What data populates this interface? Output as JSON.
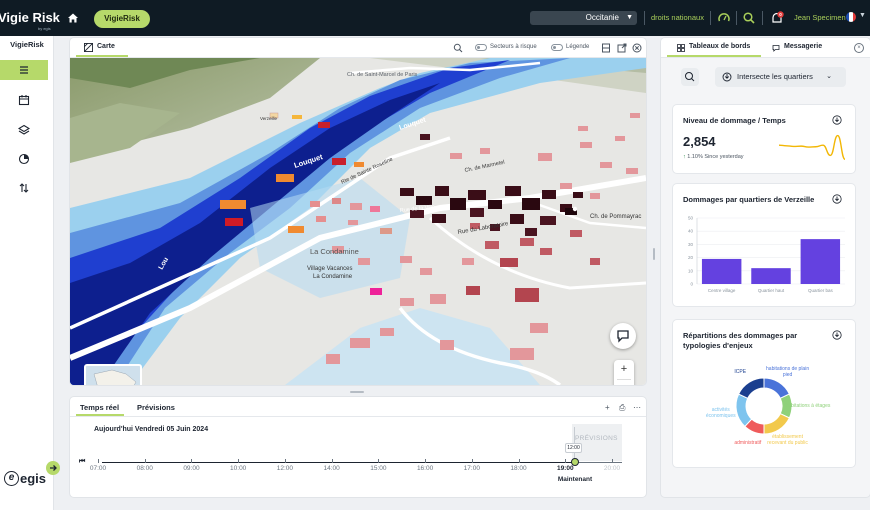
{
  "app": {
    "brand": "Vigie Risk",
    "brand_by": "by egis",
    "app_pill": "VigieRisk",
    "region_value": "Occitanie",
    "rights_label": "droits nationaux",
    "notification_count": "0",
    "user_name": "Jean Specimen",
    "nav_title": "VigieRisk",
    "footer_logo": "egis"
  },
  "map": {
    "tab_label": "Carte",
    "risk_toggle_label": "Secteurs à risque",
    "legend_toggle_label": "Légende",
    "labels": {
      "road_1": "Ch. de Saint-Marcel de Paris",
      "louquet_upper": "Louquet",
      "louquet_lower": "Louquet",
      "road_sainte_roseline": "Rte de Sainte Roseline",
      "verzeille_small": "Verzeille",
      "marmetel": "Ch. de Marmetel",
      "laboratoire": "Rue du Laboratoire",
      "pommayrac": "Ch. de Pommayrac",
      "la_condamine": "La Condamine",
      "village_vacances_1": "Village Vacances",
      "village_vacances_2": "La Condamine",
      "lou": "Lou",
      "rue_centre": "Rue de la Ville"
    }
  },
  "timeline": {
    "tab_realtime": "Temps réel",
    "tab_forecast": "Prévisions",
    "date_label": "Aujourd'hui Vendredi 05 Juin 2024",
    "forecast_zone_label": "PRÉVISIONS",
    "now_tooltip": "12:00",
    "now_caption": "Maintenant",
    "hours": [
      "07:00",
      "08:00",
      "09:00",
      "10:00",
      "12:00",
      "14:00",
      "15:00",
      "16:00",
      "17:00",
      "18:00",
      "19:00",
      "20:00"
    ],
    "current_hour": "19:00"
  },
  "dashboard": {
    "tab_dashboards": "Tableaux de bords",
    "tab_messages": "Messagerie",
    "filter_label": "Intersecte les quartiers",
    "kpi": {
      "title": "Niveau de dommage / Temps",
      "value": "2,854",
      "delta": "1.10% Since yesterday",
      "sparkline": [
        0.62,
        0.6,
        0.58,
        0.59,
        0.56,
        0.57,
        0.62,
        0.3,
        0.92,
        0.18
      ]
    },
    "bar_card": {
      "title": "Dommages par quartiers de Verzeille"
    },
    "pie_card": {
      "title": "Répartitions des dommages par typologies d'enjeux"
    }
  },
  "chart_data": [
    {
      "type": "bar",
      "title": "Dommages par quartiers de Verzeille",
      "categories": [
        "Centre village",
        "Quartier haut",
        "Quartier bas"
      ],
      "values": [
        19,
        12,
        34
      ],
      "yticks": [
        "50",
        "40",
        "30",
        "20",
        "10",
        "0"
      ],
      "ylim": [
        0,
        50
      ],
      "color": "#6441e0"
    },
    {
      "type": "pie",
      "title": "Répartitions des dommages par typologies d'enjeux",
      "series": [
        {
          "name": "habitations de plain pied",
          "value": 18,
          "color": "#4a73d9"
        },
        {
          "name": "habitations à étages",
          "value": 14,
          "color": "#8fd17a"
        },
        {
          "name": "établissement recevant du public",
          "value": 18,
          "color": "#f2c94c"
        },
        {
          "name": "administratif",
          "value": 12,
          "color": "#ef5b5b"
        },
        {
          "name": "activités économiques",
          "value": 20,
          "color": "#7ec4ee"
        },
        {
          "name": "ICPE",
          "value": 18,
          "color": "#1b3f8f"
        }
      ]
    }
  ]
}
